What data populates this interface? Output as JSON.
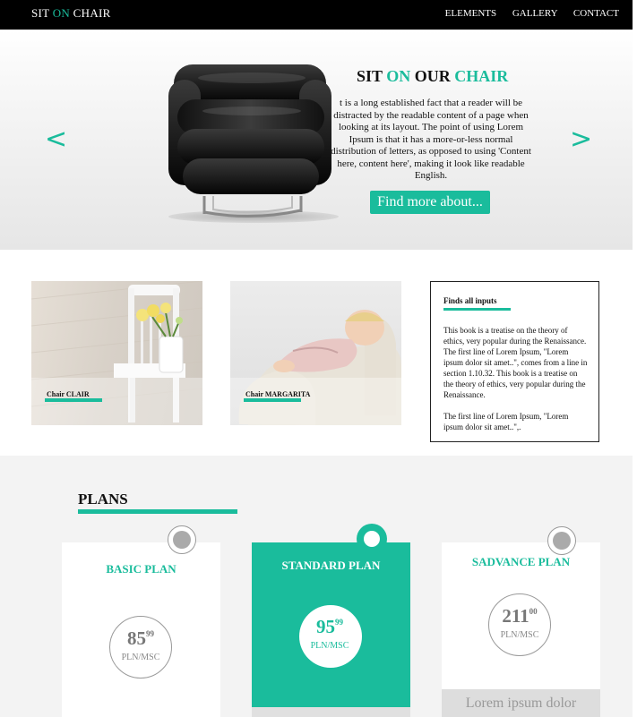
{
  "nav": {
    "brand_pre": "SIT ",
    "brand_accent": "ON",
    "brand_post": " CHAIR",
    "items": [
      "ELEMENTS",
      "GALLERY",
      "CONTACT"
    ]
  },
  "hero": {
    "title_pre": "SIT ",
    "title_accent1": "ON",
    "title_mid": " OUR ",
    "title_accent2": "CHAIR",
    "text": "t is a long established fact that a reader will be distracted by the readable content of a page when looking at its layout. The point of using Lorem Ipsum is that it has a more-or-less normal distribution of letters, as opposed to using 'Content here, content here', making it look like readable English.",
    "button": "Find more about...",
    "prev_arrow": "<",
    "next_arrow": ">"
  },
  "cards": [
    {
      "label": "Chair CLAIR"
    },
    {
      "label": "Chair MARGARITA"
    }
  ],
  "info": {
    "title": "Finds all inputs",
    "paragraphs": [
      "This book is a treatise on the theory of ethics, very popular during the Renaissance. The first line of Lorem Ipsum, \"Lorem ipsum dolor sit amet..\", comes from a line in section 1.10.32. This book is a treatise on the theory of ethics, very popular during the Renaissance.",
      "The first line of Lorem Ipsum, \"Lorem ipsum dolor sit amet..\",."
    ]
  },
  "plans": {
    "title": "PLANS",
    "items": [
      {
        "name": "BASIC PLAN",
        "price": "85",
        "cents": "99",
        "unit": "PLN/MSC"
      },
      {
        "name": "STANDARD PLAN",
        "price": "95",
        "cents": "99",
        "unit": "PLN/MSC"
      },
      {
        "name": "SADVANCE PLAN",
        "price": "211",
        "cents": "00",
        "unit": "PLN/MSC"
      }
    ],
    "footer_text": "Lorem ipsum dolor"
  },
  "colors": {
    "accent": "#1abc9c",
    "nav_bg": "#000000",
    "plans_bg": "#f3f3f3"
  }
}
